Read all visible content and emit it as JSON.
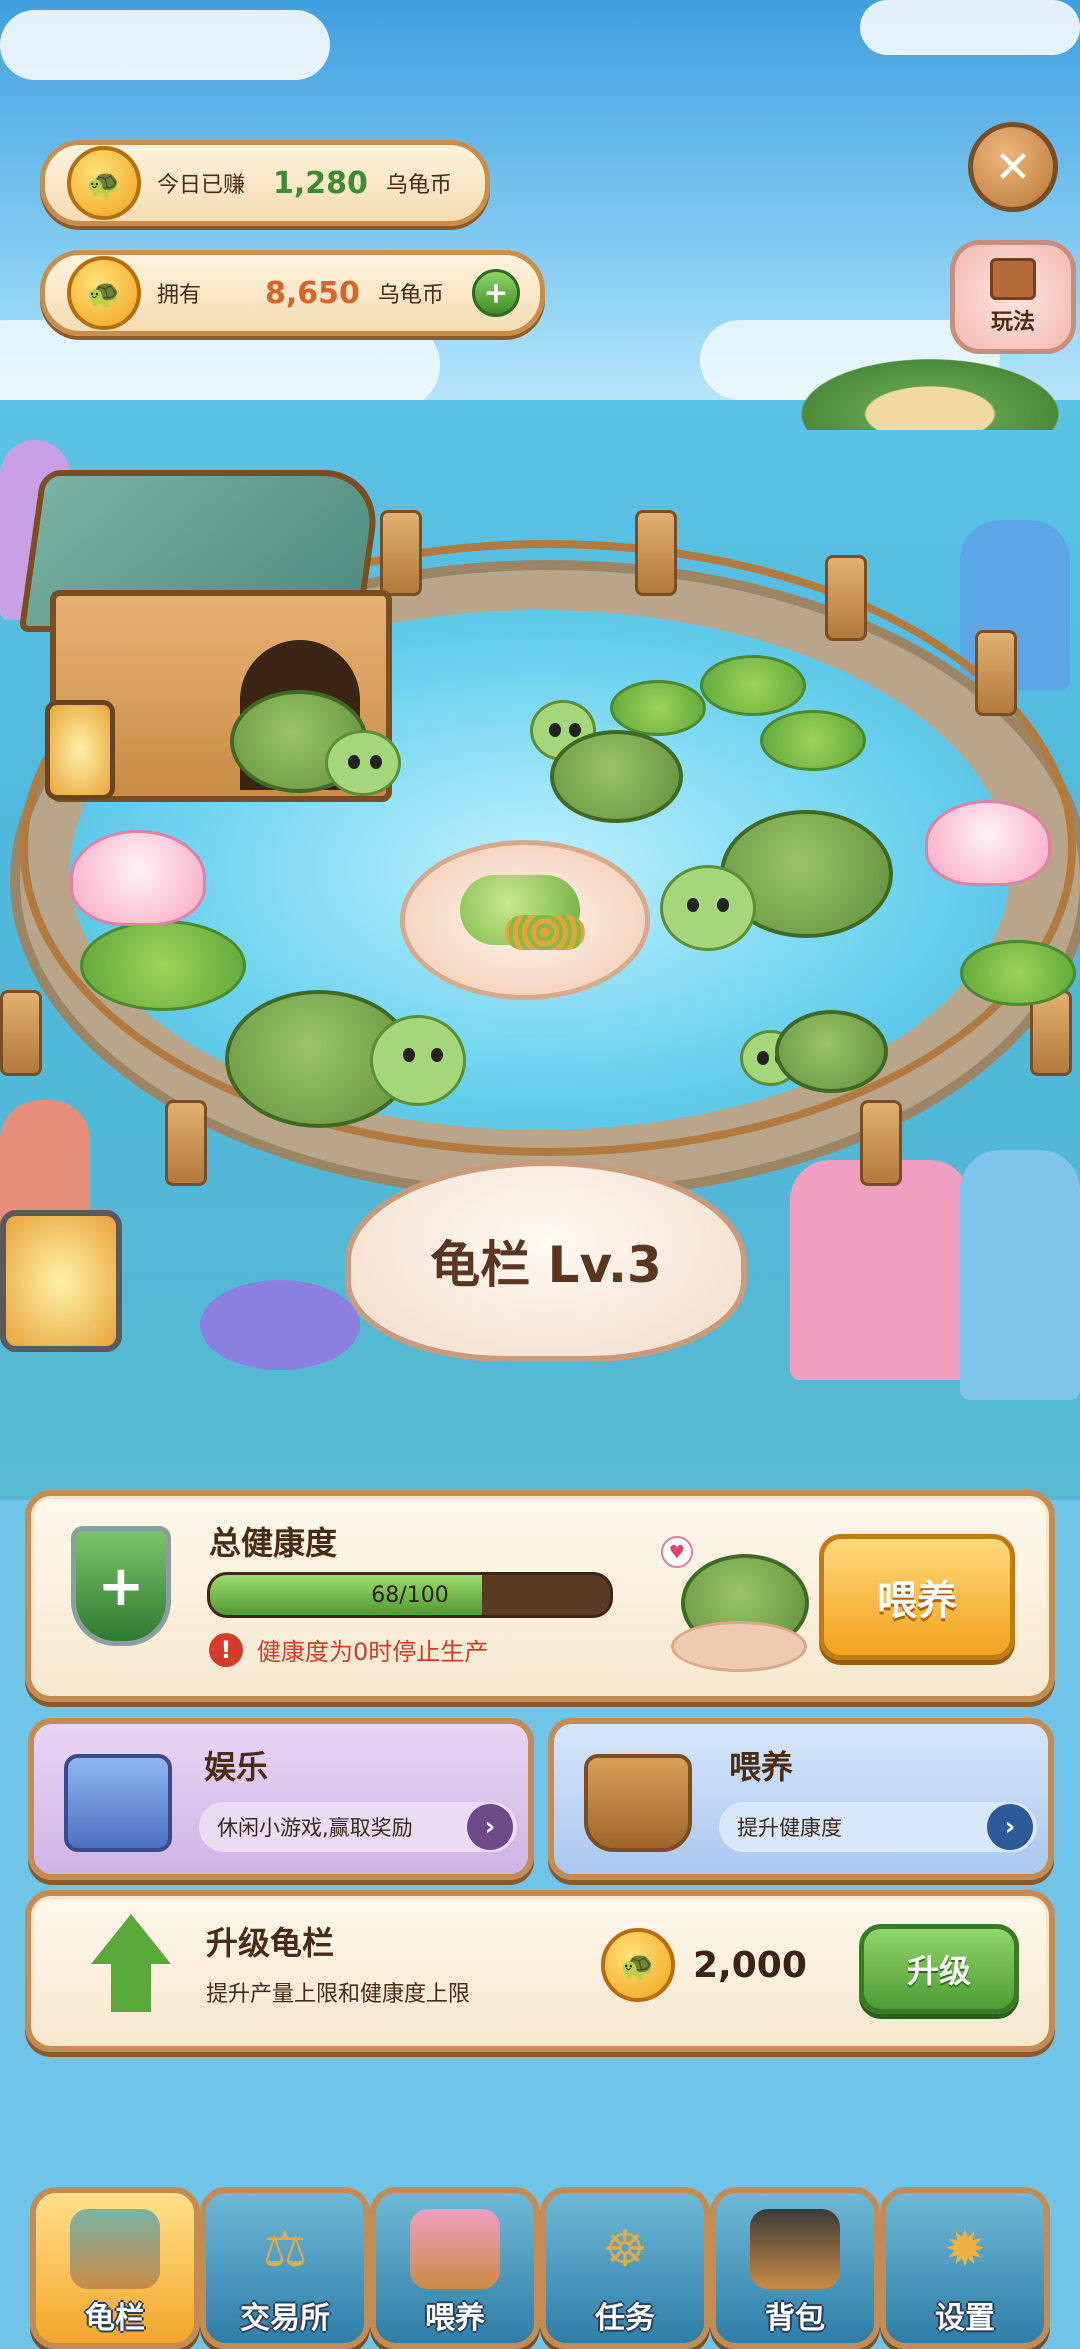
{
  "colors": {
    "earned_value": "#3f8a35",
    "owned_value": "#d9642a",
    "warning": "#d63b2a",
    "feed_button": "#f3a21f",
    "upgrade_button": "#4e9b35"
  },
  "top": {
    "earned": {
      "label": "今日已赚",
      "value": "1,280",
      "unit": "乌龟币"
    },
    "owned": {
      "label": "拥有",
      "value": "8,650",
      "unit": "乌龟币"
    },
    "close_icon": "close-icon",
    "guide_label": "玩法"
  },
  "scene": {
    "pen_title": "龟栏 Lv.3"
  },
  "health": {
    "title": "总健康度",
    "value": 68,
    "max": 100,
    "display": "68/100",
    "warning": "健康度为0时停止生产",
    "feed_label": "喂养"
  },
  "cards": {
    "entertainment": {
      "title": "娱乐",
      "desc": "休闲小游戏,赢取奖励"
    },
    "feeding": {
      "title": "喂养",
      "desc": "提升健康度"
    }
  },
  "upgrade": {
    "title": "升级龟栏",
    "desc": "提升产量上限和健康度上限",
    "cost": "2,000",
    "button": "升级"
  },
  "nav": {
    "items": [
      {
        "label": "龟栏",
        "icon": "turtle-house-icon",
        "active": true
      },
      {
        "label": "交易所",
        "icon": "scales-icon",
        "active": false
      },
      {
        "label": "喂养",
        "icon": "food-basket-icon",
        "active": false
      },
      {
        "label": "任务",
        "icon": "ship-wheel-icon",
        "active": false
      },
      {
        "label": "背包",
        "icon": "backpack-icon",
        "active": false
      },
      {
        "label": "设置",
        "icon": "compass-icon",
        "active": false
      }
    ]
  }
}
